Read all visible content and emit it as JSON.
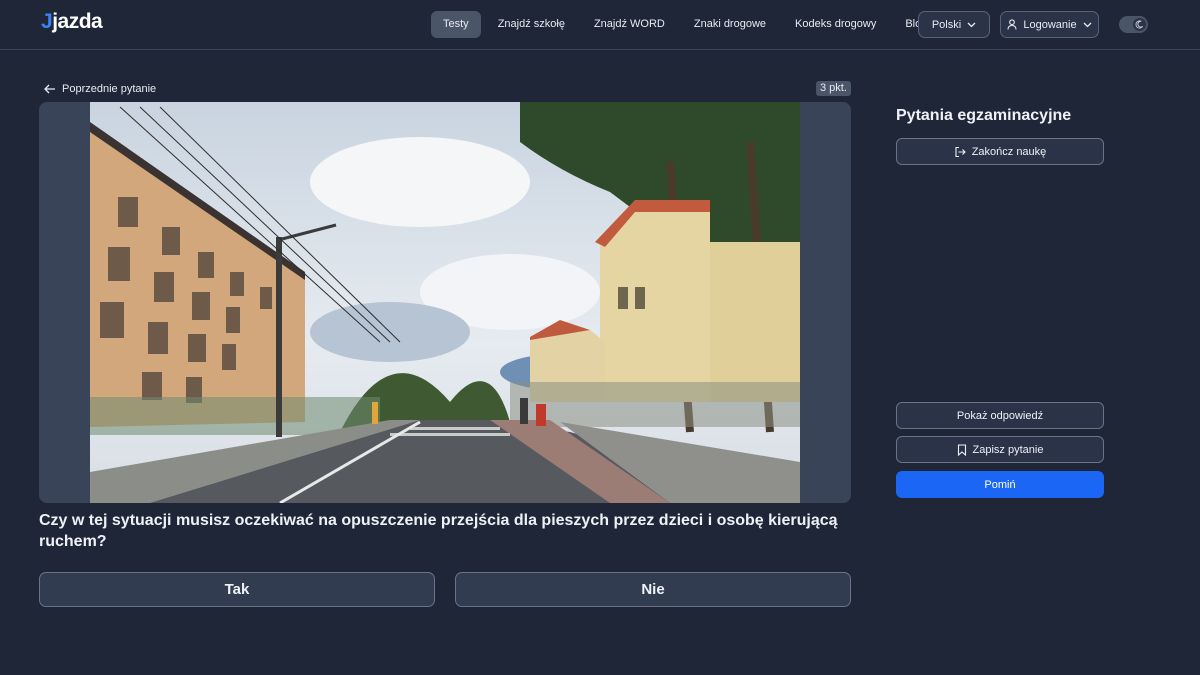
{
  "header": {
    "logo": "jazda",
    "nav": [
      "Testy",
      "Znajdź szkołę",
      "Znajdź WORD",
      "Znaki drogowe",
      "Kodeks drogowy",
      "Blog"
    ],
    "active_nav": "Testy",
    "language": "Polski",
    "login": "Logowanie",
    "theme_toggle": "dark-mode-icon"
  },
  "main": {
    "prev_label": "Poprzednie pytanie",
    "points": "3 pkt.",
    "question": "Czy w tej sytuacji musisz oczekiwać na opuszczenie przejścia dla pieszych przez dzieci i osobę kierującą ruchem?",
    "answers": [
      "Tak",
      "Nie"
    ]
  },
  "sidebar": {
    "title": "Pytania egzaminacyjne",
    "end_label": "Zakończ naukę",
    "show_answer": "Pokaż odpowiedź",
    "save_question": "Zapisz pytanie",
    "skip": "Pomiń"
  },
  "colors": {
    "background": "#1e2638",
    "accent": "#1b66f5",
    "logo_accent": "#3b82f6"
  }
}
